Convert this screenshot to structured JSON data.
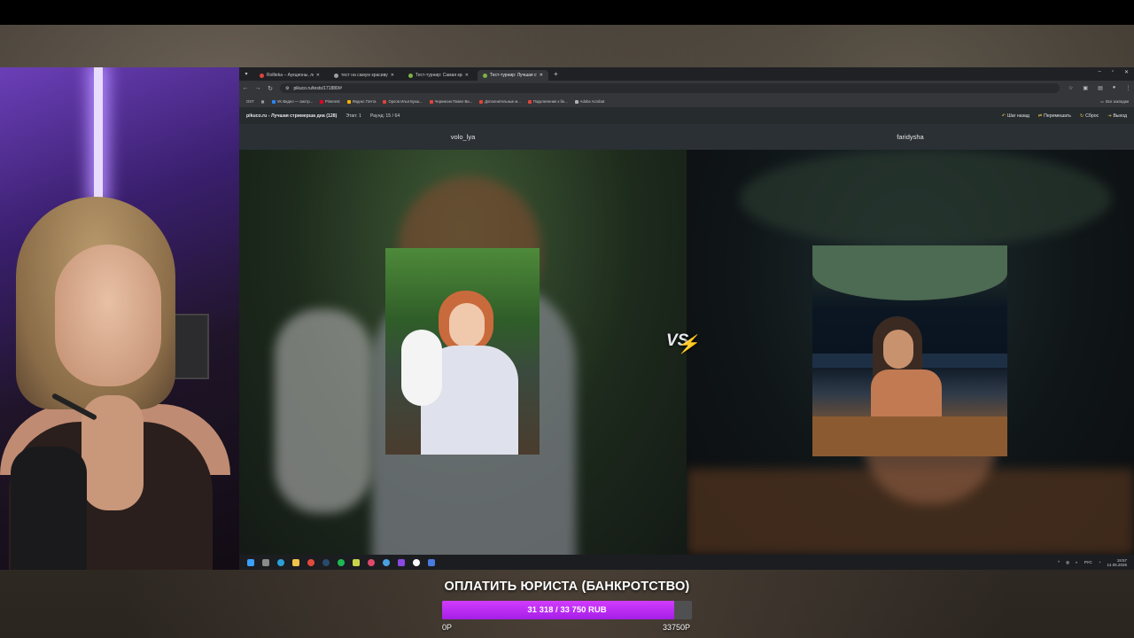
{
  "browser": {
    "tabs": [
      {
        "label": "Rollteka – Аукционы, лотерея",
        "favicon_color": "#e0443a",
        "active": false
      },
      {
        "label": "тест на самую красивую стри",
        "favicon_color": "#9aa0a6",
        "active": false
      },
      {
        "label": "Тест-турнир: Самая красивая",
        "favicon_color": "#7cb342",
        "active": false
      },
      {
        "label": "Тест-турнир: Лучшая стримерш",
        "favicon_color": "#7cb342",
        "active": true
      }
    ],
    "new_tab": "+",
    "url": "pikuco.ru/tests/171880/#",
    "bookmarks": [
      {
        "label": "VK Видео — смотр...",
        "color": "#2787f5"
      },
      {
        "label": "Pinterest",
        "color": "#e60023"
      },
      {
        "label": "Яндекс Почта",
        "color": "#f8b400"
      },
      {
        "label": "Орлов Илья Букш...",
        "color": "#e0443a"
      },
      {
        "label": "Черемсин Павел Ва...",
        "color": "#e0443a"
      },
      {
        "label": "Дополнительные м...",
        "color": "#e0443a"
      },
      {
        "label": "Подключение к бе...",
        "color": "#e0443a"
      },
      {
        "label": "Adobe Acrobat",
        "color": "#b0b0b0"
      }
    ],
    "all_bookmarks": "Все закладки",
    "apps_label": "OST"
  },
  "site": {
    "title": "pikuco.ru - Лучшая стримерша дна (128)",
    "stage": "Этап: 1",
    "round": "Раунд: 15 / 64",
    "actions": [
      "Шаг назад",
      "Перемешать",
      "Сброс",
      "Выход"
    ]
  },
  "contestants": {
    "left": {
      "name": "volo_lya"
    },
    "right": {
      "name": "faridysha"
    },
    "vs_label": "VS"
  },
  "taskbar": {
    "lang": "РУС",
    "time": "19:57",
    "date": "14.05.2026"
  },
  "donation": {
    "title": "ОПЛАТИТЬ ЮРИСТА (БАНКРОТСТВО)",
    "progress_text": "31 318 / 33 750 RUB",
    "current": 31318,
    "goal": 33750,
    "min_label": "0Р",
    "max_label": "33750Р",
    "bar_color": "#c02cf5"
  }
}
